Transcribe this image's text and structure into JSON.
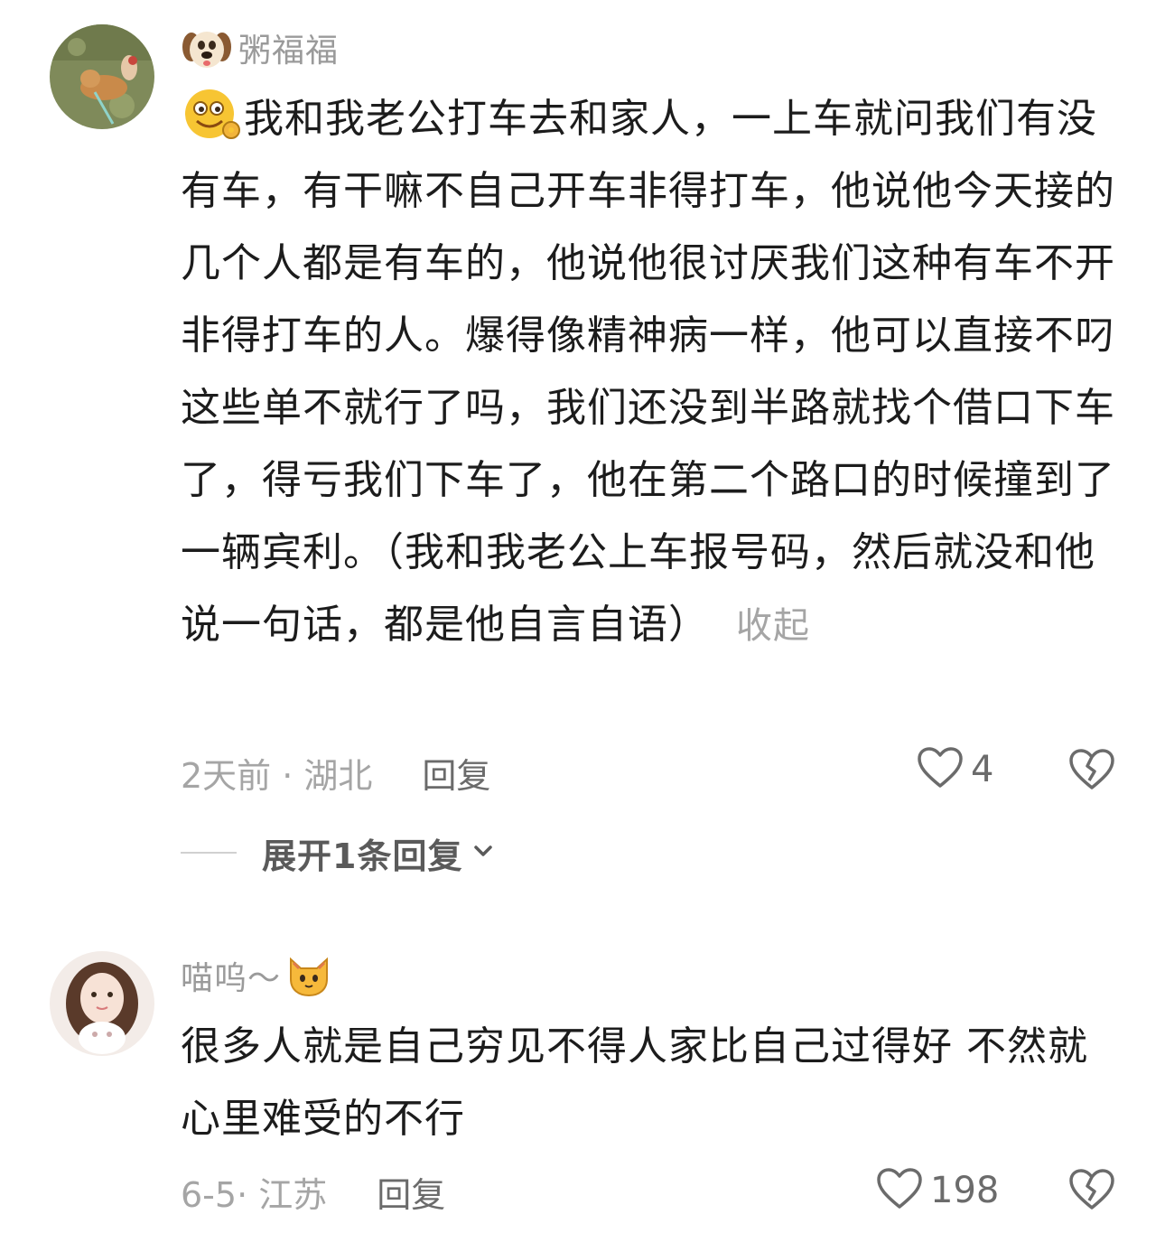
{
  "comments": [
    {
      "username": "粥福福",
      "username_emoji": "dog-face-icon",
      "body_emoji": "smiling-face-ok-hand-icon",
      "body": "我和我老公打车去和家人，一上车就问我们有没有车，有干嘛不自己开车非得打车，他说他今天接的几个人都是有车的，他说他很讨厌我们这种有车不开非得打车的人。爆得像精神病一样，他可以直接不叼这些单不就行了吗，我们还没到半路就找个借口下车了，得亏我们下车了，他在第二个路口的时候撞到了一辆宾利。（我和我老公上车报号码，然后就没和他说一句话，都是他自言自语）",
      "collapse_label": "收起",
      "time_location": "2天前 · 湖北",
      "reply_label": "回复",
      "like_count": "4",
      "expand_replies_label": "展开1条回复"
    },
    {
      "username": "喵呜～",
      "username_emoji": "cat-face-icon",
      "body": "很多人就是自己穷见不得人家比自己过得好 不然就心里难受的不行",
      "time_location": "6-5· 江苏",
      "reply_label": "回复",
      "like_count": "198"
    }
  ]
}
